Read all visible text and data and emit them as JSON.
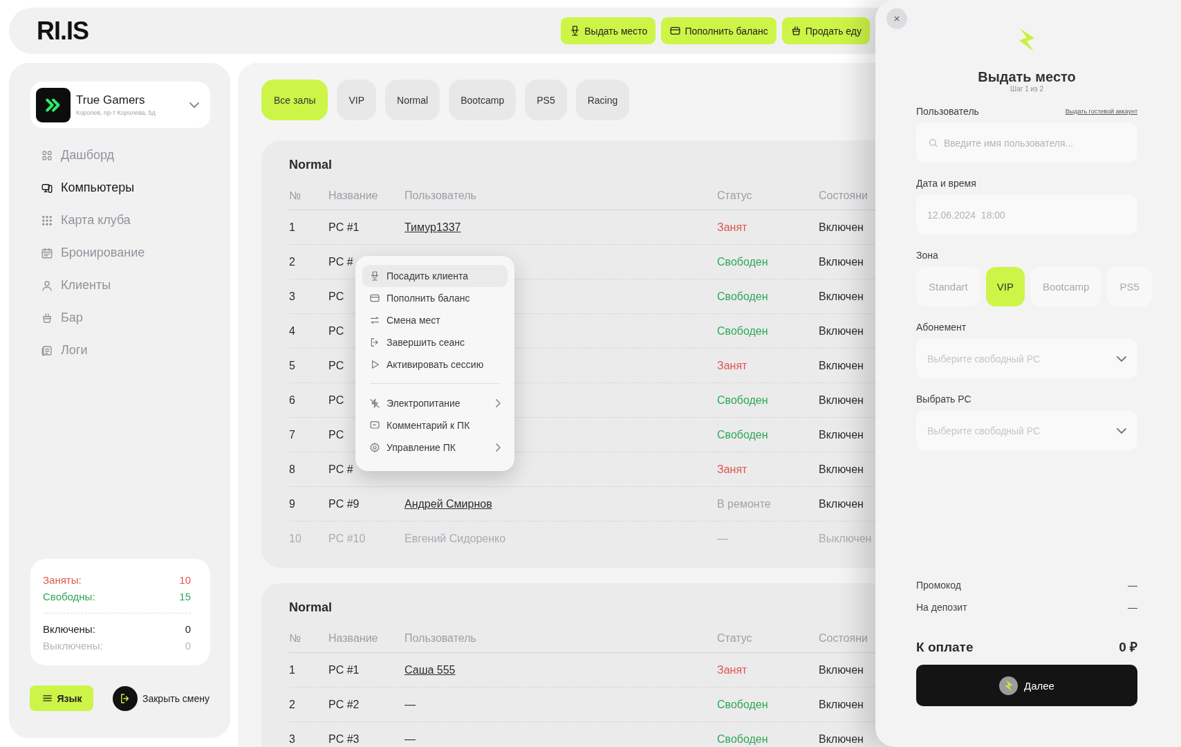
{
  "logo": {
    "text": "RI.IS"
  },
  "top_actions": [
    {
      "label": "Выдать место"
    },
    {
      "label": "Пополнить баланс"
    },
    {
      "label": "Продать еду"
    }
  ],
  "sidebar": {
    "club": {
      "name": "True Gamers",
      "address": "Королев, пр-т Королева, 5д"
    },
    "nav": [
      {
        "label": "Дашборд",
        "selected": false
      },
      {
        "label": "Компьютеры",
        "selected": true
      },
      {
        "label": "Карта клуба",
        "selected": false
      },
      {
        "label": "Бронирование",
        "selected": false
      },
      {
        "label": "Клиенты",
        "selected": false
      },
      {
        "label": "Бар",
        "selected": false
      },
      {
        "label": "Логи",
        "selected": false
      }
    ],
    "stats": [
      [
        {
          "label": "Заняты:",
          "value": "10",
          "kind": "busy"
        },
        {
          "label": "Свободны:",
          "value": "15",
          "kind": "free"
        }
      ],
      [
        {
          "label": "Включены:",
          "value": "0",
          "kind": "on"
        },
        {
          "label": "Выключены:",
          "value": "0",
          "kind": "off"
        }
      ]
    ],
    "language_button": "Язык",
    "close_shift": "Закрыть смену"
  },
  "halls": [
    {
      "label": "Все залы",
      "selected": true
    },
    {
      "label": "VIP",
      "selected": false
    },
    {
      "label": "Normal",
      "selected": false
    },
    {
      "label": "Bootcamp",
      "selected": false
    },
    {
      "label": "PS5",
      "selected": false
    },
    {
      "label": "Racing",
      "selected": false
    }
  ],
  "sections": [
    {
      "title": "Normal",
      "columns": [
        "№",
        "Название",
        "Пользователь",
        "Статус",
        "Состояни"
      ],
      "rows": [
        {
          "num": "1",
          "name": "PC #1",
          "user": "Тимур1337",
          "user_link": true,
          "status": "Занят",
          "kind": "busy",
          "power": "Включен",
          "disabled": false
        },
        {
          "num": "2",
          "name": "PC #",
          "status": "Свободен",
          "kind": "free",
          "power": "Включен",
          "disabled": false
        },
        {
          "num": "3",
          "name": "PC",
          "status": "Свободен",
          "kind": "free",
          "power": "Включен",
          "disabled": false
        },
        {
          "num": "4",
          "name": "PC",
          "status": "Свободен",
          "kind": "free",
          "power": "Включен",
          "disabled": false
        },
        {
          "num": "5",
          "name": "PC",
          "status": "Занят",
          "kind": "busy",
          "power": "Включен",
          "disabled": false
        },
        {
          "num": "6",
          "name": "PC",
          "status": "Свободен",
          "kind": "free",
          "power": "Включен",
          "disabled": false
        },
        {
          "num": "7",
          "name": "PC",
          "status": "Свободен",
          "kind": "free",
          "power": "Включен",
          "disabled": false
        },
        {
          "num": "8",
          "name": "PC #",
          "status": "Занят",
          "kind": "busy",
          "power": "Включен",
          "disabled": false
        },
        {
          "num": "9",
          "name": "PC #9",
          "user": "Андрей Смирнов",
          "user_link": true,
          "status": "В ремонте",
          "kind": "repair",
          "power": "Включен",
          "disabled": false
        },
        {
          "num": "10",
          "name": "PC #10",
          "user": "Евгений Сидоренко",
          "user_link": false,
          "status": "—",
          "kind": "none",
          "power": "Выключен",
          "disabled": true
        }
      ]
    },
    {
      "title": "Normal",
      "columns": [
        "№",
        "Название",
        "Пользователь",
        "Статус",
        "Состояни"
      ],
      "rows": [
        {
          "num": "1",
          "name": "PC #1",
          "user": "Саша 555",
          "user_link": true,
          "status": "Занят",
          "kind": "busy",
          "power": "Включен",
          "disabled": false
        },
        {
          "num": "2",
          "name": "PC #2",
          "user": "—",
          "user_link": false,
          "status": "Свободен",
          "kind": "free",
          "power": "Включен",
          "disabled": false
        },
        {
          "num": "3",
          "name": "PC #3",
          "user": "—",
          "user_link": false,
          "status": "Свободен",
          "kind": "free",
          "power": "Включен",
          "disabled": false
        }
      ]
    }
  ],
  "context_menu": {
    "groups": [
      [
        {
          "label": "Посадить клиента",
          "selected": true,
          "submenu": false
        },
        {
          "label": "Пополнить баланс",
          "selected": false,
          "submenu": false
        },
        {
          "label": "Смена мест",
          "selected": false,
          "submenu": false
        },
        {
          "label": "Завершить сеанс",
          "selected": false,
          "submenu": false
        },
        {
          "label": "Активировать сессию",
          "selected": false,
          "submenu": false
        }
      ],
      [
        {
          "label": "Электропитание",
          "selected": false,
          "submenu": true
        },
        {
          "label": "Комментарий к ПК",
          "selected": false,
          "submenu": false
        },
        {
          "label": "Управление ПК",
          "selected": false,
          "submenu": true
        }
      ]
    ]
  },
  "drawer": {
    "title": "Выдать место",
    "step": "Шаг 1 из 2",
    "user_label": "Пользователь",
    "guest_link": "Выдать гостевой аккаунт",
    "user_placeholder": "Введите имя пользователя...",
    "datetime_label": "Дата и время",
    "datetime_placeholder": "12.06.2024  18:00",
    "zone_label": "Зона",
    "zones": [
      {
        "label": "Standart",
        "selected": false
      },
      {
        "label": "VIP",
        "selected": true
      },
      {
        "label": "Bootcamp",
        "selected": false
      },
      {
        "label": "PS5",
        "selected": false
      }
    ],
    "subscription_label": "Абонемент",
    "subscription_placeholder": "Выберите свободный PC",
    "pc_label": "Выбрать PC",
    "pc_placeholder": "Выберите свободный PC",
    "summary": [
      {
        "label": "Промокод",
        "value": "—"
      },
      {
        "label": "На депозит",
        "value": "—"
      }
    ],
    "total_label": "К оплате",
    "total_value": "0 ₽",
    "next_button": "Далее"
  }
}
